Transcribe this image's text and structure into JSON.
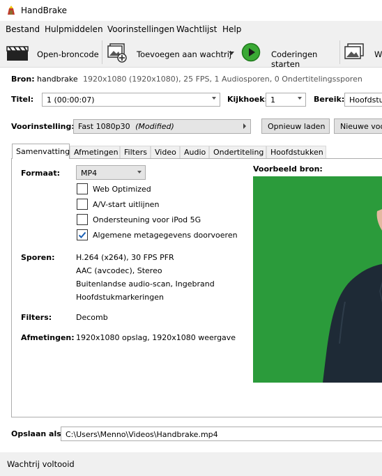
{
  "window": {
    "title": "HandBrake"
  },
  "menu": [
    "Bestand",
    "Hulpmiddelen",
    "Voorinstellingen",
    "Wachtlijst",
    "Help"
  ],
  "toolbar": {
    "open_source": "Open-broncode",
    "add_to_queue": "Toevoegen aan wachtrij",
    "start_encode": "Coderingen starten",
    "queue_partial": "W"
  },
  "source": {
    "label": "Bron:",
    "name": "handbrake",
    "details": "1920x1080 (1920x1080), 25 FPS, 1 Audiosporen, 0 Ondertitelingssporen"
  },
  "title_row": {
    "title_label": "Titel:",
    "title_value": "1  (00:00:07)",
    "angle_label": "Kijkhoek:",
    "angle_value": "1",
    "range_label": "Bereik:",
    "range_value": "Hoofdstukken"
  },
  "preset": {
    "label": "Voorinstelling:",
    "value": "Fast 1080p30",
    "modified": "(Modified)",
    "reload_button": "Opnieuw laden",
    "new_button": "Nieuwe voorinstelling"
  },
  "tabs": [
    "Samenvatting",
    "Afmetingen",
    "Filters",
    "Video",
    "Audio",
    "Ondertiteling",
    "Hoofdstukken"
  ],
  "summary": {
    "format_label": "Formaat:",
    "format_value": "MP4",
    "checkboxes": [
      {
        "label": "Web Optimized",
        "checked": false
      },
      {
        "label": "A/V-start uitlijnen",
        "checked": false
      },
      {
        "label": "Ondersteuning voor iPod 5G",
        "checked": false
      },
      {
        "label": "Algemene metagegevens doorvoeren",
        "checked": true
      }
    ],
    "tracks_label": "Sporen:",
    "tracks": [
      "H.264 (x264), 30 FPS PFR",
      "AAC (avcodec), Stereo",
      "Buitenlandse audio-scan, Ingebrand",
      "Hoofdstukmarkeringen"
    ],
    "filters_label": "Filters:",
    "filters_value": "Decomb",
    "dimensions_label": "Afmetingen:",
    "dimensions_value": "1920x1080 opslag, 1920x1080 weergave",
    "preview_label": "Voorbeeld bron:"
  },
  "save": {
    "label": "Opslaan als:",
    "path": "C:\\Users\\Menno\\Videos\\Handbrake.mp4"
  },
  "status": {
    "text": "Wachtrij voltooid"
  },
  "colors": {
    "preview_bg": "#2b9b3b",
    "accent": "#1a5fb4",
    "play_green": "#3aa935"
  }
}
